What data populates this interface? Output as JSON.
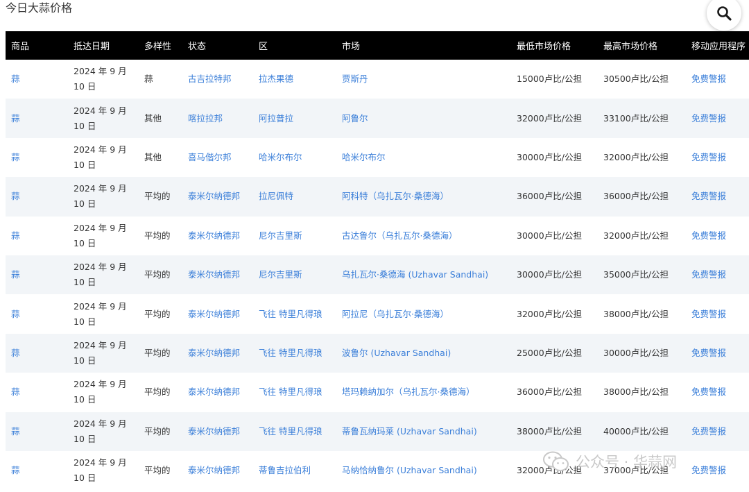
{
  "page": {
    "title": "今日大蒜价格"
  },
  "search": {
    "icon": "search-icon"
  },
  "table": {
    "headers": [
      "商品",
      "抵达日期",
      "多样性",
      "状态",
      "区",
      "市场",
      "最低市场价格",
      "最高市场价格",
      "移动应用程序"
    ],
    "rows": [
      [
        "蒜",
        "2024 年 9 月 10 日",
        "蒜",
        "古吉拉特邦",
        "拉杰果德",
        "贾斯丹",
        "15000卢比/公担",
        "30500卢比/公担",
        "免费警报"
      ],
      [
        "蒜",
        "2024 年 9 月 10 日",
        "其他",
        "喀拉拉邦",
        "阿拉普拉",
        "阿鲁尔",
        "32000卢比/公担",
        "33100卢比/公担",
        "免费警报"
      ],
      [
        "蒜",
        "2024 年 9 月 10 日",
        "其他",
        "喜马偕尔邦",
        "哈米尔布尔",
        "哈米尔布尔",
        "30000卢比/公担",
        "32000卢比/公担",
        "免费警报"
      ],
      [
        "蒜",
        "2024 年 9 月 10 日",
        "平均的",
        "泰米尔纳德邦",
        "拉尼佩特",
        "阿科特（乌扎瓦尔·桑德海）",
        "36000卢比/公担",
        "36000卢比/公担",
        "免费警报"
      ],
      [
        "蒜",
        "2024 年 9 月 10 日",
        "平均的",
        "泰米尔纳德邦",
        "尼尔吉里斯",
        "古达鲁尔（乌扎瓦尔·桑德海）",
        "30000卢比/公担",
        "32000卢比/公担",
        "免费警报"
      ],
      [
        "蒜",
        "2024 年 9 月 10 日",
        "平均的",
        "泰米尔纳德邦",
        "尼尔吉里斯",
        "乌扎瓦尔·桑德海 (Uzhavar Sandhai)",
        "30000卢比/公担",
        "35000卢比/公担",
        "免费警报"
      ],
      [
        "蒜",
        "2024 年 9 月 10 日",
        "平均的",
        "泰米尔纳德邦",
        "飞往 特里凡得琅",
        "阿拉尼（乌扎瓦尔·桑德海）",
        "32000卢比/公担",
        "38000卢比/公担",
        "免费警报"
      ],
      [
        "蒜",
        "2024 年 9 月 10 日",
        "平均的",
        "泰米尔纳德邦",
        "飞往 特里凡得琅",
        "波鲁尔 (Uzhavar Sandhai)",
        "25000卢比/公担",
        "30000卢比/公担",
        "免费警报"
      ],
      [
        "蒜",
        "2024 年 9 月 10 日",
        "平均的",
        "泰米尔纳德邦",
        "飞往 特里凡得琅",
        "塔玛赖纳加尔（乌扎瓦尔·桑德海）",
        "36000卢比/公担",
        "38000卢比/公担",
        "免费警报"
      ],
      [
        "蒜",
        "2024 年 9 月 10 日",
        "平均的",
        "泰米尔纳德邦",
        "飞往 特里凡得琅",
        "蒂鲁瓦纳玛莱 (Uzhavar Sandhai)",
        "38000卢比/公担",
        "40000卢比/公担",
        "免费警报"
      ],
      [
        "蒜",
        "2024 年 9 月 10 日",
        "平均的",
        "泰米尔纳德邦",
        "蒂鲁吉拉伯利",
        "马纳恰纳鲁尔 (Uzhavar Sandhai)",
        "32000卢比/公担",
        "37000卢比/公担",
        "免费警报"
      ]
    ]
  },
  "watermark": {
    "text": "公众号 · 华蒜网",
    "icon": "wechat-icon"
  },
  "colors": {
    "header_bg": "#000000",
    "link": "#3b7fd9",
    "row_alt": "#f2f5f8"
  }
}
